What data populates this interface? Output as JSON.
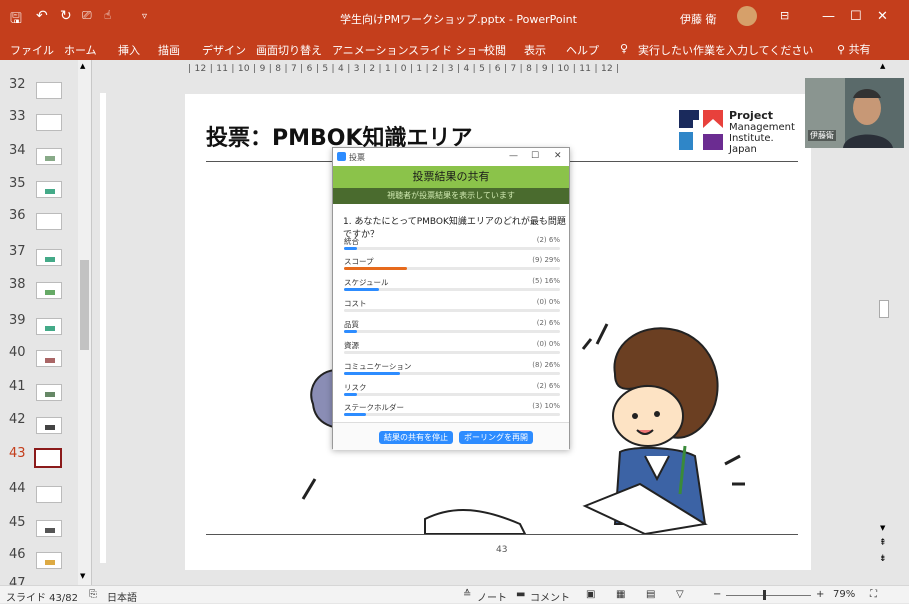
{
  "titlebar": {
    "save_icon": "save-icon",
    "undo_icon": "undo-icon",
    "redo_icon": "redo-icon",
    "title": "学生向けPMワークショップ.pptx  -  PowerPoint",
    "user": "伊藤 衛",
    "min": "—",
    "max": "☐",
    "close": "✕"
  },
  "ribbon": {
    "tabs": [
      "ファイル",
      "ホーム",
      "挿入",
      "描画",
      "デザイン",
      "画面切り替え",
      "アニメーション",
      "スライド ショー",
      "校閲",
      "表示",
      "ヘルプ"
    ],
    "search": "実行したい作業を入力してください",
    "share": "共有"
  },
  "thumbnails": [
    "32",
    "33",
    "34",
    "35",
    "36",
    "37",
    "38",
    "39",
    "40",
    "41",
    "42",
    "43",
    "44",
    "45",
    "46",
    "47"
  ],
  "selected_thumbnail": "43",
  "ruler": "| 12 | 11 | 10 | 9 | 8 | 7 | 6 | 5 | 4 | 3 | 2 | 1 | 0 | 1 | 2 | 3 | 4 | 5 | 6 | 7 | 8 | 9 | 10 | 11 | 12 |",
  "slide": {
    "title": "投票：PMBOK知識エリア",
    "pmi_line1": "Project",
    "pmi_line2": "Management",
    "pmi_line3": "Institute.",
    "pmi_line4": "Japan",
    "number": "43"
  },
  "camera": {
    "name": "伊藤衛"
  },
  "poll": {
    "window_title": "投票",
    "header": "投票結果の共有",
    "subheader": "視聴者が投票結果を表示しています",
    "question": "1. あなたにとってPMBOK知識エリアのどれが最も問題ですか？",
    "options": [
      {
        "label": "統合",
        "value": "(2) 6%",
        "pct": 6
      },
      {
        "label": "スコープ",
        "value": "(9) 29%",
        "pct": 29
      },
      {
        "label": "スケジュール",
        "value": "(5) 16%",
        "pct": 16
      },
      {
        "label": "コスト",
        "value": "(0) 0%",
        "pct": 0
      },
      {
        "label": "品質",
        "value": "(2) 6%",
        "pct": 6
      },
      {
        "label": "資源",
        "value": "(0) 0%",
        "pct": 0
      },
      {
        "label": "コミュニケーション",
        "value": "(8) 26%",
        "pct": 26
      },
      {
        "label": "リスク",
        "value": "(2) 6%",
        "pct": 6
      },
      {
        "label": "ステークホルダー",
        "value": "(3) 10%",
        "pct": 10
      }
    ],
    "stop_share": "結果の共有を停止",
    "restart": "ポーリングを再開",
    "highlight_color": "#e66a1c",
    "bar_color": "#2d8cff"
  },
  "status": {
    "slide": "スライド 43/82",
    "lang": "日本語",
    "notes": "ノート",
    "comments": "コメント",
    "zoom": "79%",
    "zoom_minus": "−",
    "zoom_plus": "+"
  }
}
